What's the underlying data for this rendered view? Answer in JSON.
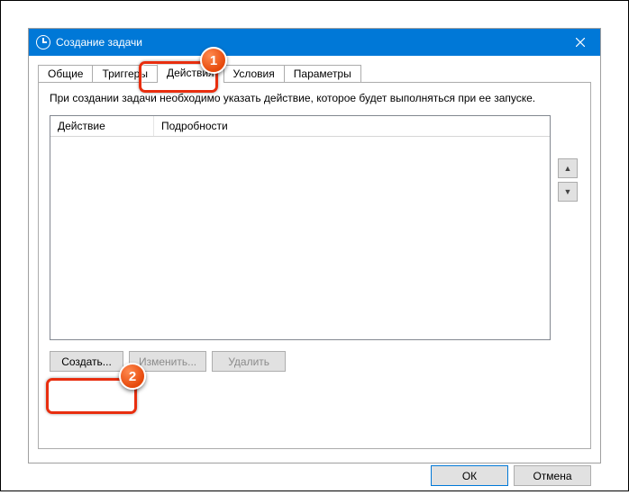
{
  "window": {
    "title": "Создание задачи"
  },
  "tabs": [
    {
      "label": "Общие"
    },
    {
      "label": "Триггеры"
    },
    {
      "label": "Действия"
    },
    {
      "label": "Условия"
    },
    {
      "label": "Параметры"
    }
  ],
  "activeTabIndex": 2,
  "panel": {
    "instruction": "При создании задачи необходимо указать действие, которое будет выполняться при ее запуске.",
    "columns": {
      "action": "Действие",
      "details": "Подробности"
    },
    "buttons": {
      "create": "Создать...",
      "edit": "Изменить...",
      "delete": "Удалить"
    }
  },
  "dialogButtons": {
    "ok": "ОК",
    "cancel": "Отмена"
  },
  "annotations": {
    "badge1": "1",
    "badge2": "2"
  }
}
